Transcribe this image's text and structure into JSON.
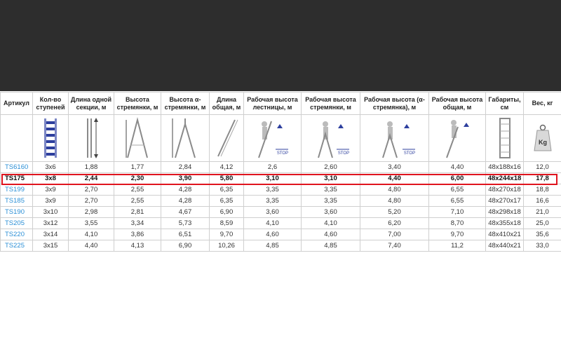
{
  "columns": [
    "Артикул",
    "Кол-во ступеней",
    "Длина одной секции, м",
    "Высота стремянки, м",
    "Высота α-стремянки, м",
    "Длина общая, м",
    "Рабочая высота лестницы, м",
    "Рабочая высота стремянки, м",
    "Рабочая высота (α-стремянка), м",
    "Рабочая высота общая, м",
    "Габариты, см",
    "Вес, кг"
  ],
  "icons": [
    "ladder-section-icon",
    "section-length-icon",
    "stepladder-height-icon",
    "alpha-stepladder-height-icon",
    "total-length-icon",
    "working-height-ladder-icon",
    "working-height-stepladder-icon",
    "working-height-alpha-icon",
    "working-height-total-icon",
    "dimensions-icon",
    "weight-icon"
  ],
  "stop_label": "STOP",
  "weight_label": "Kg",
  "highlight_color": "#e0141e",
  "link_color": "#2b8fd6",
  "rows": [
    [
      "TS6160",
      "3x6",
      "1,88",
      "1,77",
      "2,84",
      "4,12",
      "2,6",
      "2,60",
      "3,40",
      "4,40",
      "48x188x16",
      "12,0"
    ],
    [
      "TS175",
      "3x8",
      "2,44",
      "2,30",
      "3,90",
      "5,80",
      "3,10",
      "3,10",
      "4,40",
      "6,00",
      "48x244x18",
      "17,8"
    ],
    [
      "TS199",
      "3x9",
      "2,70",
      "2,55",
      "4,28",
      "6,35",
      "3,35",
      "3,35",
      "4,80",
      "6,55",
      "48x270x18",
      "18,8"
    ],
    [
      "TS185",
      "3x9",
      "2,70",
      "2,55",
      "4,28",
      "6,35",
      "3,35",
      "3,35",
      "4,80",
      "6,55",
      "48x270x17",
      "16,6"
    ],
    [
      "TS190",
      "3x10",
      "2,98",
      "2,81",
      "4,67",
      "6,90",
      "3,60",
      "3,60",
      "5,20",
      "7,10",
      "48x298x18",
      "21,0"
    ],
    [
      "TS205",
      "3x12",
      "3,55",
      "3,34",
      "5,73",
      "8,59",
      "4,10",
      "4,10",
      "6,20",
      "8,70",
      "48x355x18",
      "25,0"
    ],
    [
      "TS220",
      "3x14",
      "4,10",
      "3,86",
      "6,51",
      "9,70",
      "4,60",
      "4,60",
      "7,00",
      "9,70",
      "48x410x21",
      "35,6"
    ],
    [
      "TS225",
      "3x15",
      "4,40",
      "4,13",
      "6,90",
      "10,26",
      "4,85",
      "4,85",
      "7,40",
      "11,2",
      "48x440x21",
      "33,0"
    ]
  ],
  "highlighted_row": 1
}
